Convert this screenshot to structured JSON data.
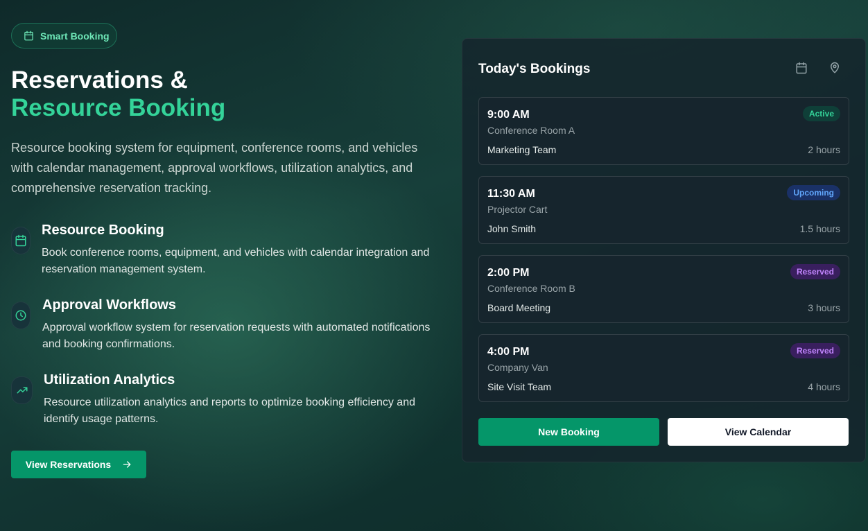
{
  "pill": {
    "label": "Smart Booking",
    "icon": "calendar-icon"
  },
  "hero": {
    "title_line1": "Reservations &",
    "title_line2": "Resource Booking",
    "description": "Resource booking system for equipment, conference rooms, and vehicles with calendar management, approval workflows, utilization analytics, and comprehensive reservation tracking."
  },
  "features": [
    {
      "icon": "calendar-icon",
      "title": "Resource Booking",
      "description": "Book conference rooms, equipment, and vehicles with calendar integration and reservation management system."
    },
    {
      "icon": "clock-icon",
      "title": "Approval Workflows",
      "description": "Approval workflow system for reservation requests with automated notifications and booking confirmations."
    },
    {
      "icon": "trending-up-icon",
      "title": "Utilization Analytics",
      "description": "Resource utilization analytics and reports to optimize booking efficiency and identify usage patterns."
    }
  ],
  "cta": {
    "label": "View Reservations",
    "icon": "arrow-right-icon"
  },
  "panel": {
    "title": "Today's Bookings",
    "icons": [
      "calendar-icon",
      "map-pin-icon"
    ],
    "bookings": [
      {
        "time": "9:00 AM",
        "resource": "Conference Room A",
        "booked_by": "Marketing Team",
        "duration": "2 hours",
        "status": "Active"
      },
      {
        "time": "11:30 AM",
        "resource": "Projector Cart",
        "booked_by": "John Smith",
        "duration": "1.5 hours",
        "status": "Upcoming"
      },
      {
        "time": "2:00 PM",
        "resource": "Conference Room B",
        "booked_by": "Board Meeting",
        "duration": "3 hours",
        "status": "Reserved"
      },
      {
        "time": "4:00 PM",
        "resource": "Company Van",
        "booked_by": "Site Visit Team",
        "duration": "4 hours",
        "status": "Reserved"
      }
    ],
    "new_booking_label": "New Booking",
    "view_calendar_label": "View Calendar"
  },
  "colors": {
    "accent": "#34d399",
    "button": "#059669",
    "active": "#34d399",
    "upcoming": "#60a5fa",
    "reserved": "#c084fc"
  }
}
